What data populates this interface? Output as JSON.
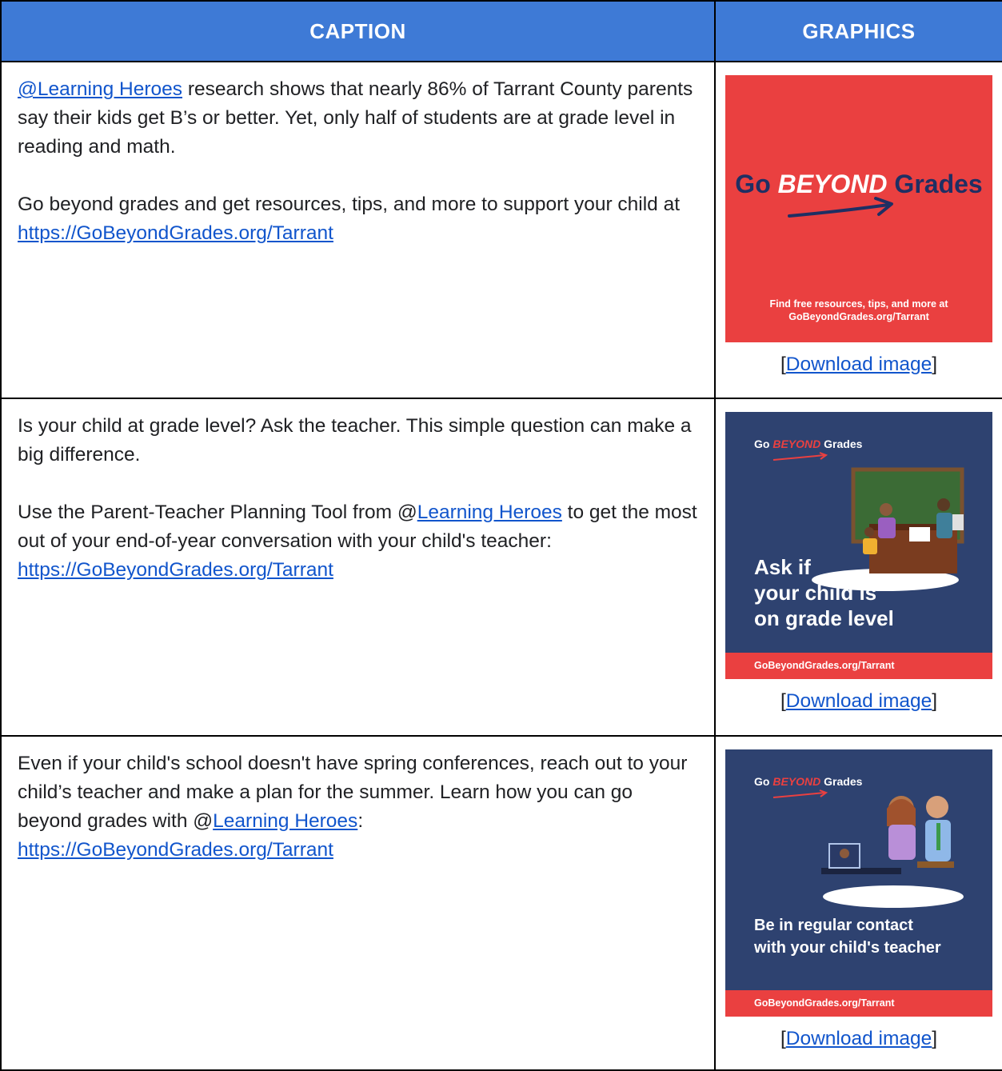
{
  "header": {
    "caption": "CAPTION",
    "graphics": "GRAPHICS"
  },
  "rows": [
    {
      "caption": {
        "p1_link": "@Learning Heroes",
        "p1_text": " research shows that nearly 86% of Tarrant County parents say their kids get B’s or better. Yet, only half of students are at grade level in reading and math.",
        "p2_text": "Go beyond grades and get resources, tips, and more to support your child at ",
        "p2_link": "https://GoBeyondGrades.org/Tarrant"
      },
      "graphic": {
        "brand_go": "Go ",
        "brand_beyond": "BEYOND",
        "brand_grades": " Grades",
        "footer_line1": "Find free resources, tips, and more at",
        "footer_line2": "GoBeyondGrades.org/Tarrant",
        "background_color": "#ea4040"
      },
      "download": {
        "open": "[",
        "label": "Download image",
        "close": "]"
      }
    },
    {
      "caption": {
        "p1_text": "Is your child at grade level? Ask the teacher. This simple question can make a big difference.",
        "p2_prefix": "Use the Parent-Teacher Planning Tool from @",
        "p2_link1": "Learning Heroes",
        "p2_middle": " to get the most out of your end-of-year conversation with your child's teacher: ",
        "p2_link2": "https://GoBeyondGrades.org/Tarrant"
      },
      "graphic": {
        "brand_go": "Go ",
        "brand_beyond": "BEYOND",
        "brand_grades": " Grades",
        "headline_line1": "Ask if",
        "headline_line2": "your child is",
        "headline_line3": "on grade level",
        "footer": "GoBeyondGrades.org/Tarrant",
        "background_color": "#2e4270"
      },
      "download": {
        "open": "[",
        "label": "Download image",
        "close": "]"
      }
    },
    {
      "caption": {
        "p1_prefix": "Even if your child's school doesn't have spring conferences, reach out to your child’s teacher and make a plan for the summer. Learn how you can go beyond grades with @",
        "p1_link1": "Learning Heroes",
        "p1_suffix": ":",
        "p1_link2": "https://GoBeyondGrades.org/Tarrant"
      },
      "graphic": {
        "brand_go": "Go ",
        "brand_beyond": "BEYOND",
        "brand_grades": " Grades",
        "headline_line1": "Be in regular contact",
        "headline_line2": "with your child's teacher",
        "footer": "GoBeyondGrades.org/Tarrant",
        "background_color": "#2e4270"
      },
      "download": {
        "open": "[",
        "label": "Download image",
        "close": "]"
      }
    }
  ]
}
